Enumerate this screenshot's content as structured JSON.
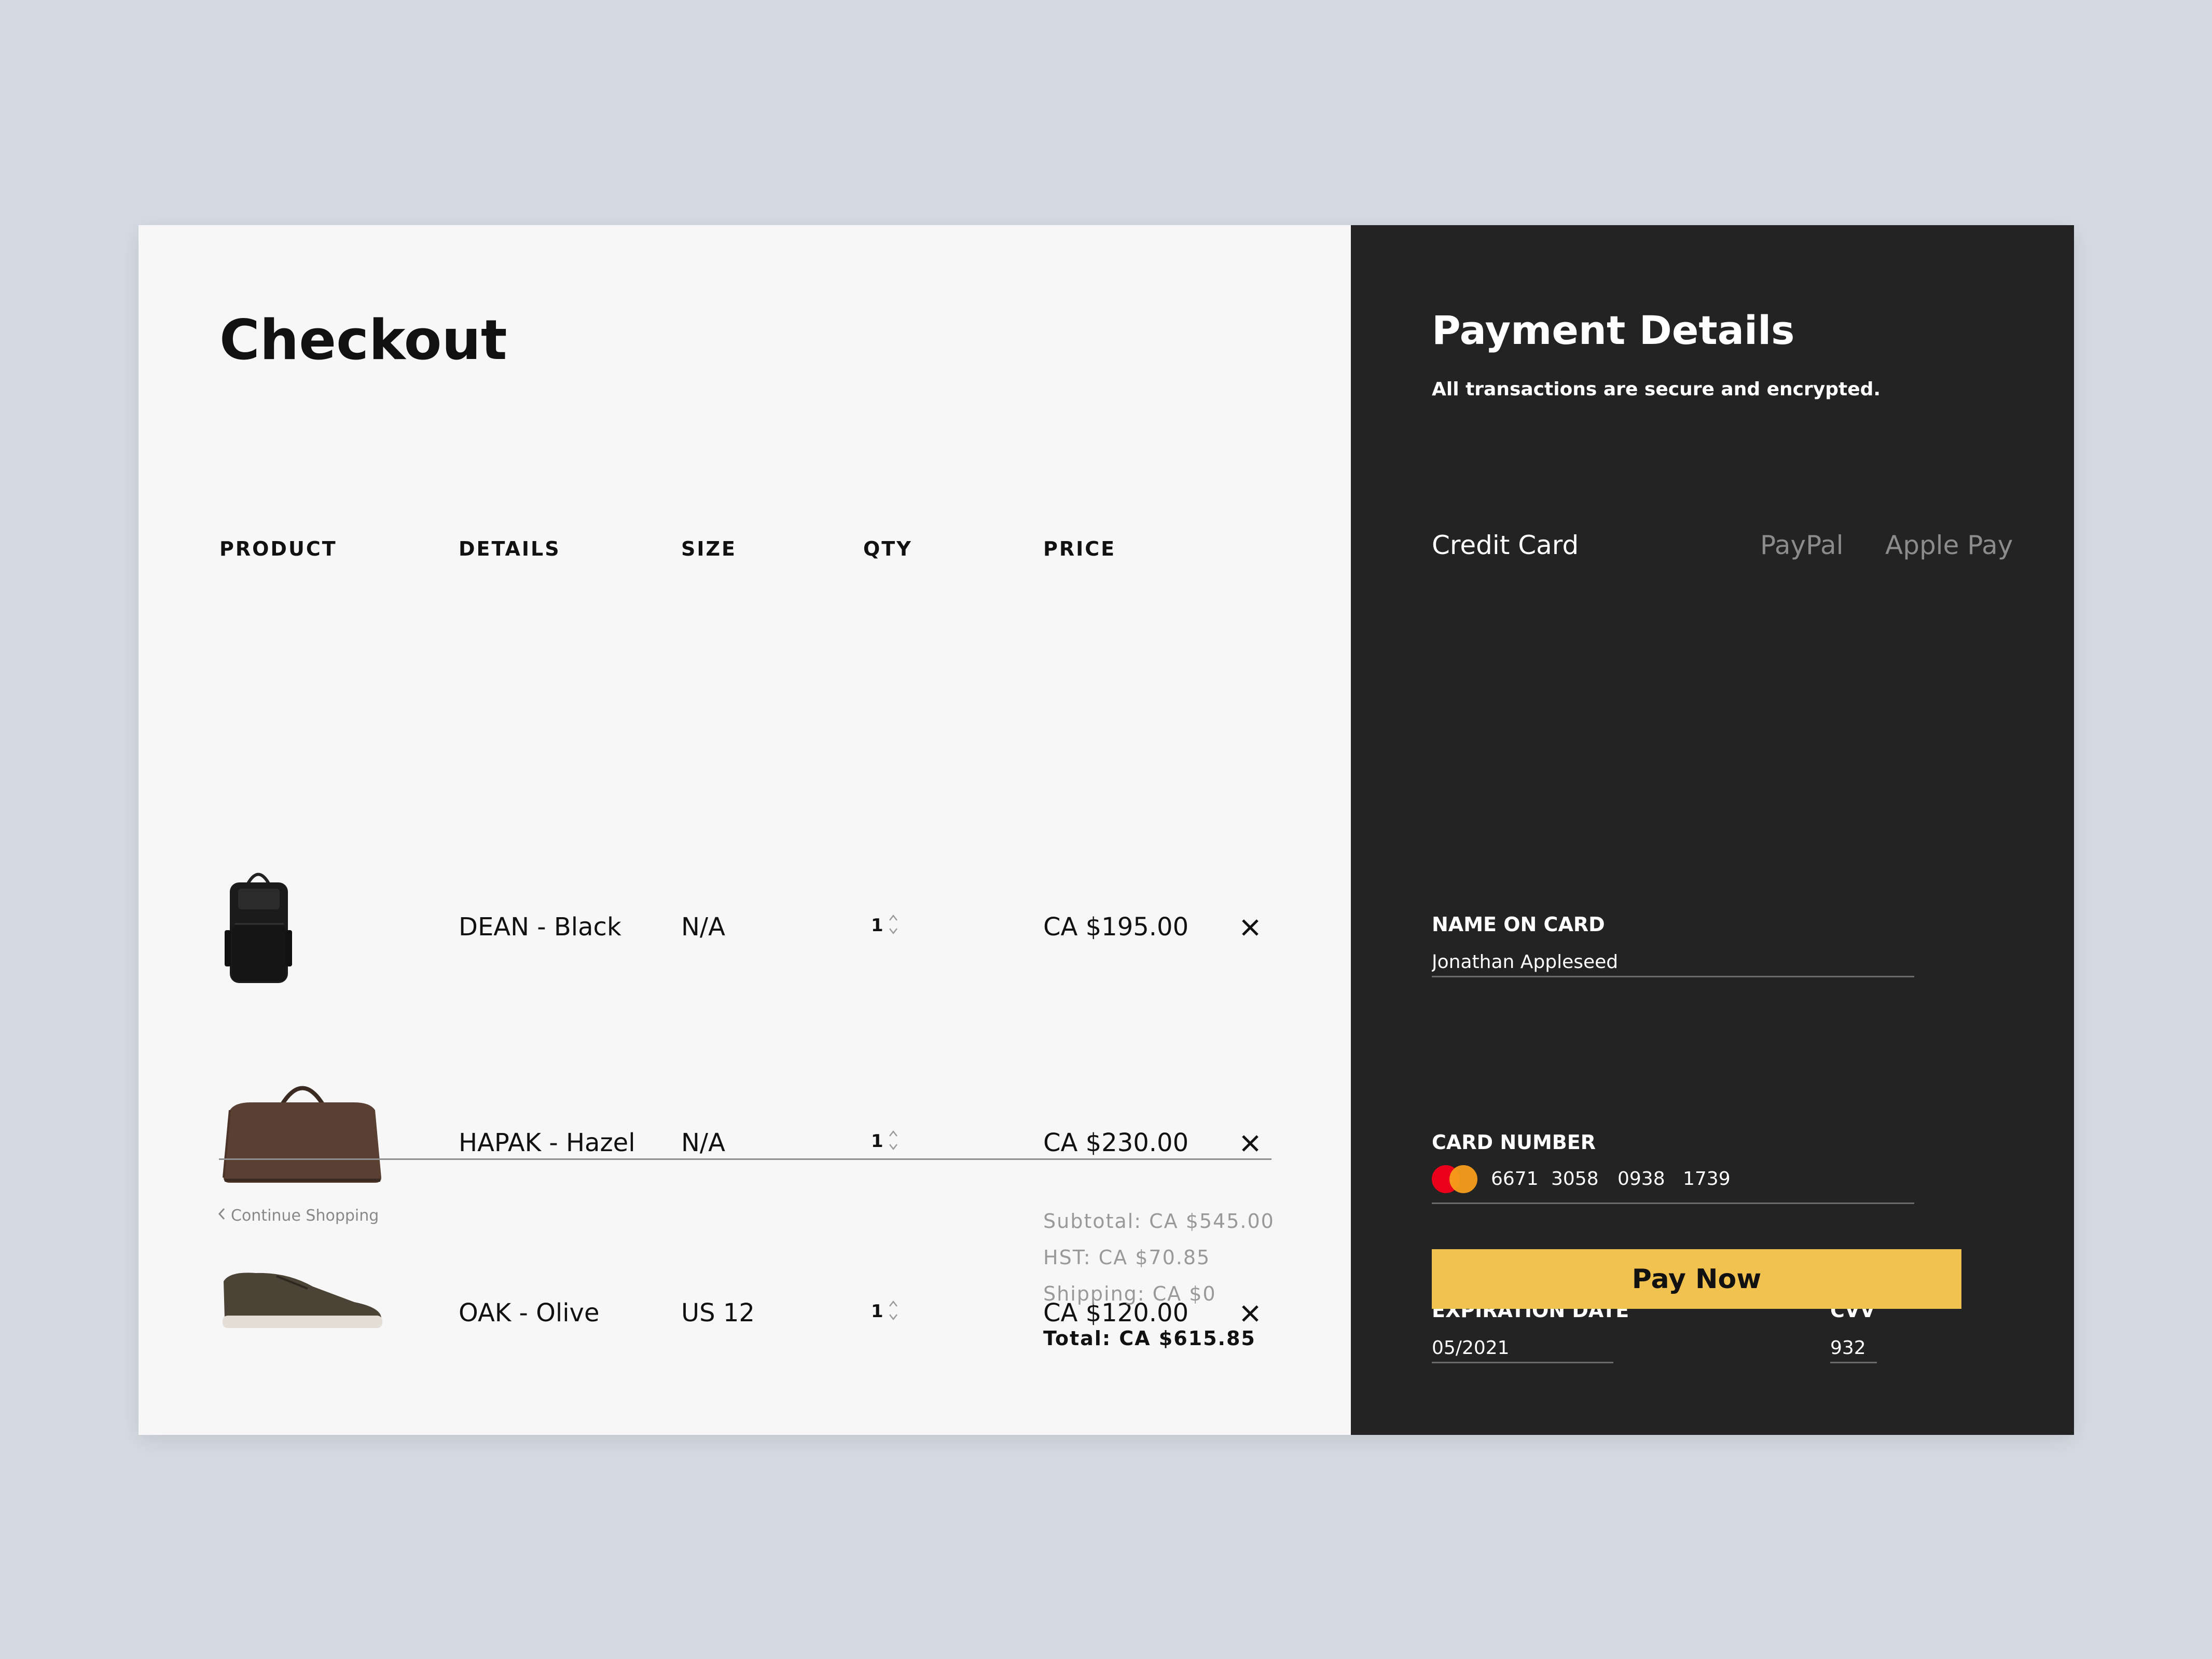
{
  "checkout": {
    "title": "Checkout",
    "columns": [
      "PRODUCT",
      "DETAILS",
      "SIZE",
      "QTY",
      "PRICE"
    ],
    "items": [
      {
        "details": "DEAN - Black",
        "size": "N/A",
        "qty": "1",
        "price": "CA $195.00",
        "image": "backpack-image"
      },
      {
        "details": "HAPAK - Hazel",
        "size": "N/A",
        "qty": "1",
        "price": "CA $230.00",
        "image": "duffel-bag-image"
      },
      {
        "details": "OAK - Olive",
        "size": "US 12",
        "qty": "1",
        "price": "CA $120.00",
        "image": "sneaker-image"
      }
    ],
    "continue_label": "Continue Shopping",
    "summary": {
      "subtotal": "Subtotal: CA $545.00",
      "hst": "HST: CA $70.85",
      "shipping": "Shipping: CA $0",
      "total": "Total: CA $615.85"
    }
  },
  "payment": {
    "title": "Payment Details",
    "subtitle": "All transactions are secure and encrypted.",
    "tabs": [
      {
        "label": "Credit Card",
        "active": true
      },
      {
        "label": "PayPal",
        "active": false
      },
      {
        "label": "Apple Pay",
        "active": false
      }
    ],
    "name_label": "NAME ON CARD",
    "name_value": "Jonathan Appleseed",
    "card_label": "CARD NUMBER",
    "card_groups": [
      "6671",
      "3058",
      "0938",
      "1739"
    ],
    "card_brand_icon": "mastercard-icon",
    "exp_label": "EXPIRATION DATE",
    "exp_value": "05/2021",
    "cvv_label": "CVV",
    "cvv_value": "932",
    "pay_label": "Pay Now"
  },
  "colors": {
    "page_bg": "#d6dae2",
    "left_bg": "#f7f7f7",
    "right_bg": "#232323",
    "pay_button": "#f2c250"
  }
}
